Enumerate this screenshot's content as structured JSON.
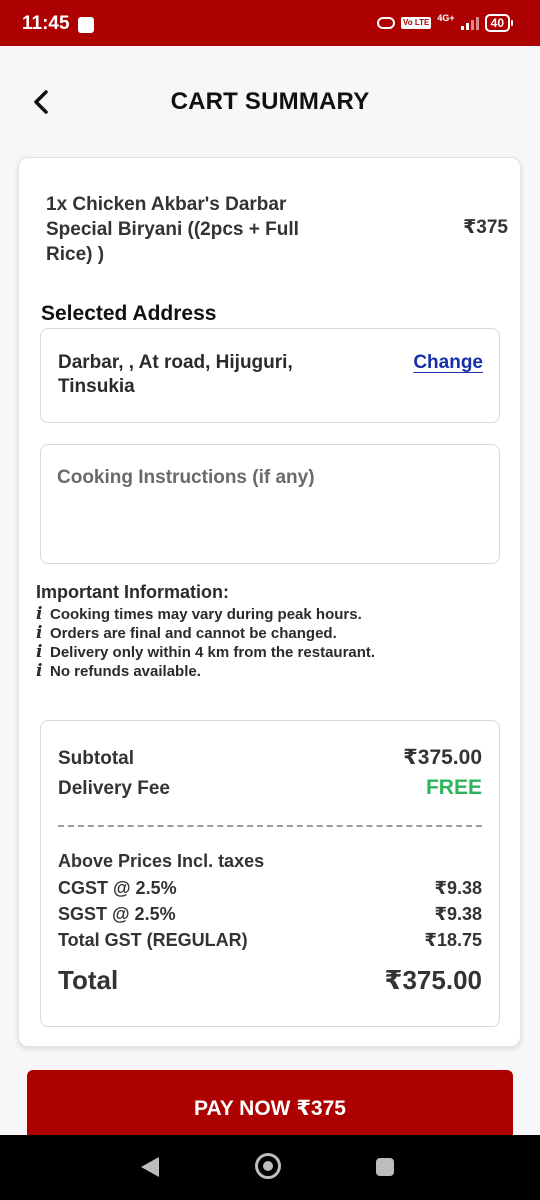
{
  "status_bar": {
    "time": "11:45",
    "volte": "Vo LTE",
    "network": "4G+",
    "battery": "40",
    "icons": [
      "notification-square-icon",
      "link-icon",
      "volte-icon",
      "signal-icon",
      "battery-icon"
    ]
  },
  "header": {
    "title": "CART SUMMARY",
    "back_icon": "chevron-left-icon"
  },
  "cart": {
    "item_name": "1x Chicken Akbar's Darbar Special Biryani ((2pcs + Full Rice) )",
    "item_price": "₹375"
  },
  "address": {
    "heading": "Selected Address",
    "text": "Darbar, , At road, Hijuguri, Tinsukia",
    "change_label": "Change"
  },
  "cooking": {
    "placeholder": "Cooking Instructions (if any)"
  },
  "info": {
    "heading": "Important Information:",
    "icon": "i",
    "lines": [
      "Cooking times may vary during peak hours.",
      "Orders are final and cannot be changed.",
      "Delivery only within 4 km from the restaurant.",
      "No refunds available."
    ]
  },
  "totals": {
    "subtotal_label": "Subtotal",
    "subtotal_value": "₹375.00",
    "delivery_label": "Delivery Fee",
    "delivery_value": "FREE",
    "taxes_note": "Above Prices Incl. taxes",
    "cgst_label": "CGST @ 2.5%",
    "cgst_value": "₹9.38",
    "sgst_label": "SGST @ 2.5%",
    "sgst_value": "₹9.38",
    "gst_label": "Total GST (REGULAR)",
    "gst_value": "₹18.75",
    "total_label": "Total",
    "total_value": "₹375.00"
  },
  "pay_button": {
    "label": "PAY NOW ₹375"
  },
  "colors": {
    "brand": "#ad0000",
    "free": "#2db55d",
    "link": "#1631a8"
  }
}
